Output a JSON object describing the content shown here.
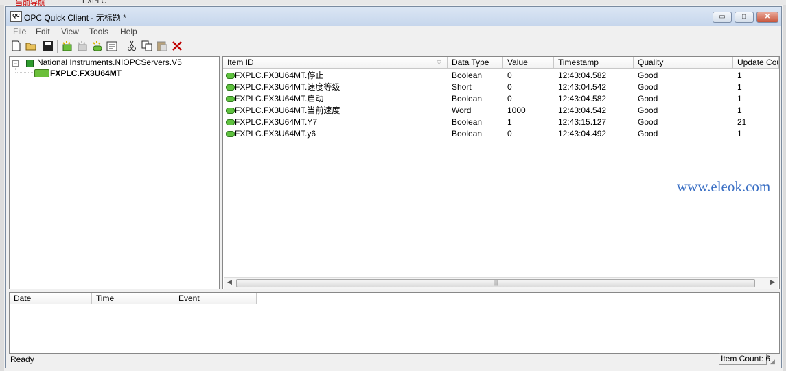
{
  "background": {
    "tab_text_left": "当前导航",
    "tab_text_right": "FXPLC"
  },
  "watermark": "www.eleok.com",
  "window": {
    "title": "OPC Quick Client - 无标题 *",
    "app_icon_text": "QC",
    "buttons": {
      "minimize": "▭",
      "maximize": "□",
      "close": "✕"
    }
  },
  "menu": [
    "File",
    "Edit",
    "View",
    "Tools",
    "Help"
  ],
  "toolbar": {
    "icons": [
      "new-file-icon",
      "open-folder-icon",
      "save-disk-icon",
      "new-server-icon",
      "new-group-icon",
      "new-item-icon",
      "properties-icon",
      "cut-icon",
      "copy-icon",
      "paste-icon",
      "delete-icon"
    ]
  },
  "tree": {
    "server": "National Instruments.NIOPCServers.V5",
    "expander": "−",
    "group": "FXPLC.FX3U64MT"
  },
  "list": {
    "columns": [
      "Item ID",
      "Data Type",
      "Value",
      "Timestamp",
      "Quality",
      "Update Count"
    ],
    "rows": [
      [
        "FXPLC.FX3U64MT.停止",
        "Boolean",
        "0",
        "12:43:04.582",
        "Good",
        "1"
      ],
      [
        "FXPLC.FX3U64MT.速度等级",
        "Short",
        "0",
        "12:43:04.542",
        "Good",
        "1"
      ],
      [
        "FXPLC.FX3U64MT.启动",
        "Boolean",
        "0",
        "12:43:04.582",
        "Good",
        "1"
      ],
      [
        "FXPLC.FX3U64MT.当前速度",
        "Word",
        "1000",
        "12:43:04.542",
        "Good",
        "1"
      ],
      [
        "FXPLC.FX3U64MT.Y7",
        "Boolean",
        "1",
        "12:43:15.127",
        "Good",
        "21"
      ],
      [
        "FXPLC.FX3U64MT.y6",
        "Boolean",
        "0",
        "12:43:04.492",
        "Good",
        "1"
      ]
    ]
  },
  "events": {
    "columns": [
      "Date",
      "Time",
      "Event"
    ]
  },
  "status": {
    "text": "Ready",
    "item_count": "Item Count: 6"
  }
}
